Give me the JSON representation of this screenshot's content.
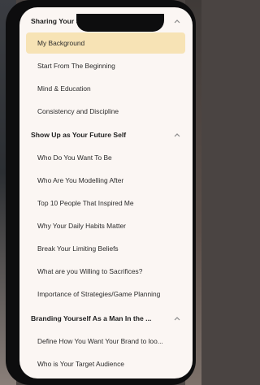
{
  "sections": [
    {
      "title": "Sharing Your Story",
      "items": [
        {
          "label": "My Background",
          "active": true
        },
        {
          "label": "Start From The Beginning"
        },
        {
          "label": "Mind & Education"
        },
        {
          "label": "Consistency and Discipline"
        }
      ]
    },
    {
      "title": "Show Up as Your Future Self",
      "items": [
        {
          "label": "Who Do You Want To Be"
        },
        {
          "label": "Who Are You Modelling After"
        },
        {
          "label": "Top 10 People That Inspired Me"
        },
        {
          "label": "Why Your Daily Habits Matter"
        },
        {
          "label": "Break Your Limiting Beliefs"
        },
        {
          "label": "What are you Willing to Sacrifices?"
        },
        {
          "label": "Importance of Strategies/Game Planning"
        }
      ]
    },
    {
      "title": "Branding Yourself As a Man In the ...",
      "items": [
        {
          "label": "Define How You Want Your Brand to loo..."
        },
        {
          "label": "Who is Your Target Audience"
        }
      ]
    }
  ]
}
